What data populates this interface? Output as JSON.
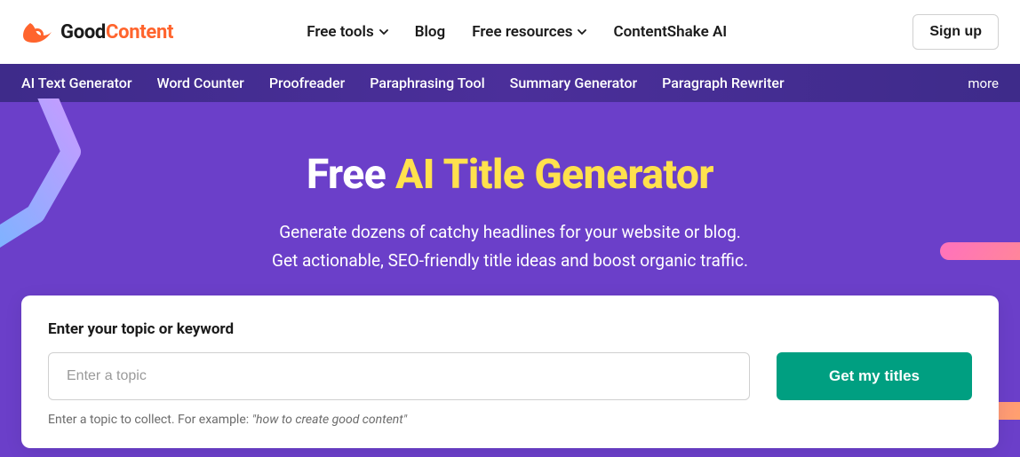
{
  "header": {
    "logo_good": "Good",
    "logo_content": "Content",
    "nav": [
      {
        "label": "Free tools",
        "dropdown": true
      },
      {
        "label": "Blog",
        "dropdown": false
      },
      {
        "label": "Free resources",
        "dropdown": true
      },
      {
        "label": "ContentShake AI",
        "dropdown": false
      }
    ],
    "signup": "Sign up"
  },
  "subnav": {
    "items": [
      "AI Text Generator",
      "Word Counter",
      "Proofreader",
      "Paraphrasing Tool",
      "Summary Generator",
      "Paragraph Rewriter"
    ],
    "more": "more"
  },
  "hero": {
    "title_prefix": "Free ",
    "title_highlight": "AI Title Generator",
    "description_line1": "Generate dozens of catchy headlines for your website or blog.",
    "description_line2": "Get actionable, SEO-friendly title ideas and boost organic traffic."
  },
  "form": {
    "label": "Enter your topic or keyword",
    "placeholder": "Enter a topic",
    "submit": "Get my titles",
    "hint_prefix": "Enter a topic to collect. For example: ",
    "hint_example": "\"how to create good content\""
  }
}
